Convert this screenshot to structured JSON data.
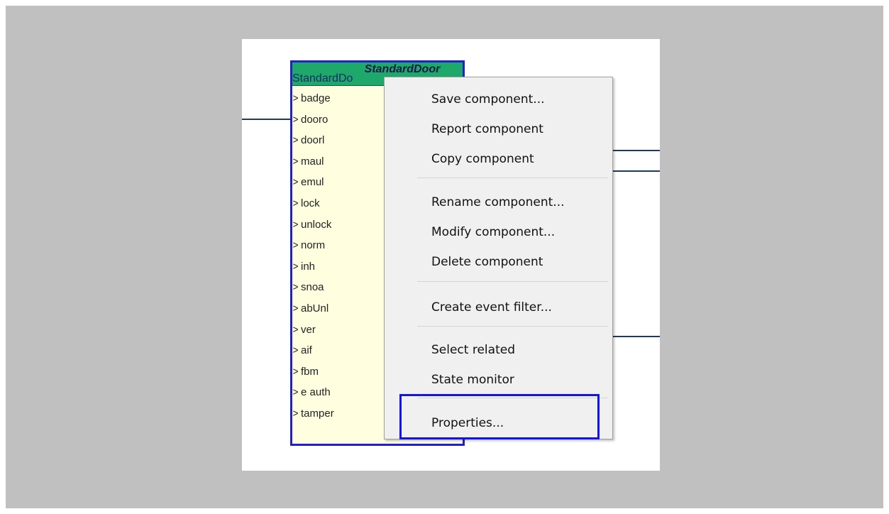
{
  "component": {
    "title": "StandardDoor",
    "type_label": "StandardDo",
    "ports": [
      "badge",
      "dooro",
      "doorl",
      "maul",
      "emul",
      "lock",
      "unlock",
      "norm",
      "inh",
      "snoa",
      "abUnl",
      "ver",
      "aif",
      "fbm",
      "e auth",
      "tamper"
    ]
  },
  "context_menu": {
    "groups": [
      [
        "Save component...",
        "Report component",
        "Copy component"
      ],
      [
        "Rename component...",
        "Modify component...",
        "Delete component"
      ],
      [
        "Create event filter..."
      ],
      [
        "Select related",
        "State monitor"
      ],
      [
        "Properties..."
      ]
    ],
    "highlighted_item": "Properties..."
  },
  "colors": {
    "header_green": "#1ea86a",
    "component_border": "#1f1fd9",
    "component_body": "#ffffe0",
    "highlight": "#1414e6",
    "menu_bg": "#f0f0f0"
  }
}
